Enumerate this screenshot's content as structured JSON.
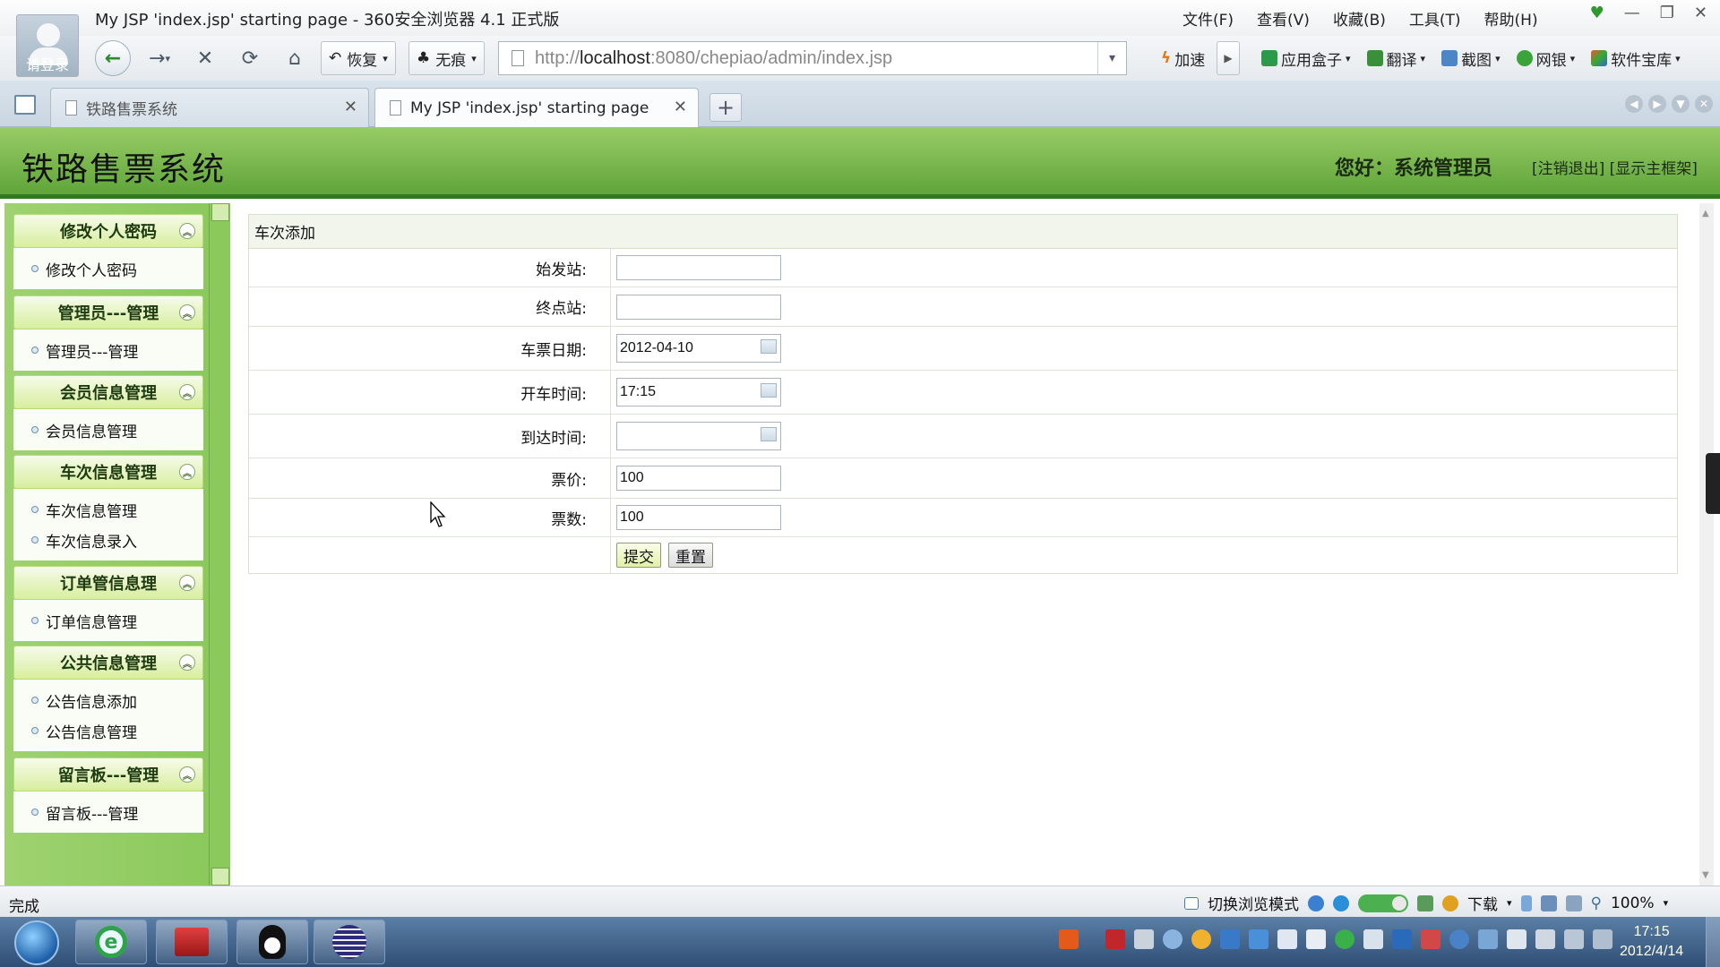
{
  "browser": {
    "window_title": "My JSP 'index.jsp' starting page - 360安全浏览器 4.1 正式版",
    "login_label": "请登录",
    "menu": [
      "文件(F)",
      "查看(V)",
      "收藏(B)",
      "工具(T)",
      "帮助(H)"
    ],
    "restore_label": "恢复",
    "incognito_label": "无痕",
    "url_prefix": "http://",
    "url_host": "localhost",
    "url_rest": ":8080/chepiao/admin/index.jsp",
    "speed_label": "加速",
    "tools": {
      "appbox": "应用盒子",
      "translate": "翻译",
      "screenshot": "截图",
      "bank": "网银",
      "software": "软件宝库"
    },
    "tabs": [
      {
        "label": "铁路售票系统",
        "active": false
      },
      {
        "label": "My JSP 'index.jsp' starting page",
        "active": true
      }
    ],
    "status_text": "完成",
    "status_mode_label": "切换浏览模式",
    "download_label": "下载",
    "zoom": "100%"
  },
  "header": {
    "title": "铁路售票系统",
    "welcome": "您好：系统管理员",
    "links": "[注销退出] [显示主框架]"
  },
  "sidebar": {
    "groups": [
      {
        "title": "修改个人密码",
        "items": [
          "修改个人密码"
        ]
      },
      {
        "title": "管理员---管理",
        "items": [
          "管理员---管理"
        ]
      },
      {
        "title": "会员信息管理",
        "items": [
          "会员信息管理"
        ]
      },
      {
        "title": "车次信息管理",
        "items": [
          "车次信息管理",
          "车次信息录入"
        ]
      },
      {
        "title": "订单管信息理",
        "items": [
          "订单信息管理"
        ]
      },
      {
        "title": "公共信息管理",
        "items": [
          "公告信息添加",
          "公告信息管理"
        ]
      },
      {
        "title": "留言板---管理",
        "items": [
          "留言板---管理"
        ]
      }
    ]
  },
  "form": {
    "caption": "车次添加",
    "fields": {
      "start_station": {
        "label": "始发站:",
        "value": ""
      },
      "end_station": {
        "label": "终点站:",
        "value": ""
      },
      "ticket_date": {
        "label": "车票日期:",
        "value": "2012-04-10"
      },
      "depart_time": {
        "label": "开车时间:",
        "value": "17:15"
      },
      "arrive_time": {
        "label": "到达时间:",
        "value": ""
      },
      "price": {
        "label": "票价:",
        "value": "100"
      },
      "count": {
        "label": "票数:",
        "value": "100"
      }
    },
    "submit_label": "提交",
    "reset_label": "重置"
  },
  "taskbar": {
    "time": "17:15",
    "date": "2012/4/14"
  }
}
